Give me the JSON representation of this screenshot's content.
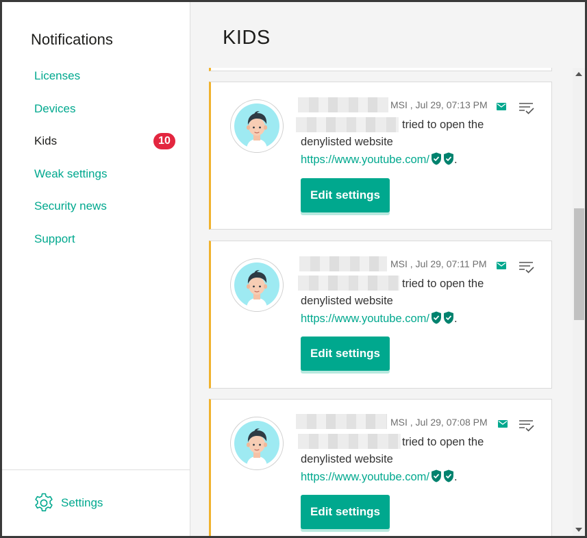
{
  "sidebar": {
    "title": "Notifications",
    "items": [
      {
        "label": "Licenses",
        "active": false
      },
      {
        "label": "Devices",
        "active": false
      },
      {
        "label": "Kids",
        "active": true,
        "badge": "10"
      },
      {
        "label": "Weak settings",
        "active": false
      },
      {
        "label": "Security news",
        "active": false
      },
      {
        "label": "Support",
        "active": false
      }
    ],
    "settings_label": "Settings"
  },
  "main": {
    "title": "KIDS",
    "notifications": [
      {
        "meta": "MSI , Jul 29, 07:13 PM",
        "action": "tried to open the",
        "line2": "denylisted website",
        "url": "https://www.youtube.com/",
        "punct": ".",
        "button": "Edit settings"
      },
      {
        "meta": "MSI , Jul 29, 07:11 PM",
        "action": "tried to open the",
        "line2": "denylisted website",
        "url": "https://www.youtube.com/",
        "punct": ".",
        "button": "Edit settings"
      },
      {
        "meta": "MSI , Jul 29, 07:08 PM",
        "action": "tried to open the",
        "line2": "denylisted website",
        "url": "https://www.youtube.com/",
        "punct": ".",
        "button": "Edit settings"
      }
    ]
  },
  "colors": {
    "accent": "#00a88e",
    "badge": "#e3263f",
    "card_stripe": "#f0b22d"
  },
  "icons": [
    "gear-icon",
    "mail-icon",
    "mark-as-read-icon",
    "shield-check-icon",
    "child-avatar"
  ]
}
